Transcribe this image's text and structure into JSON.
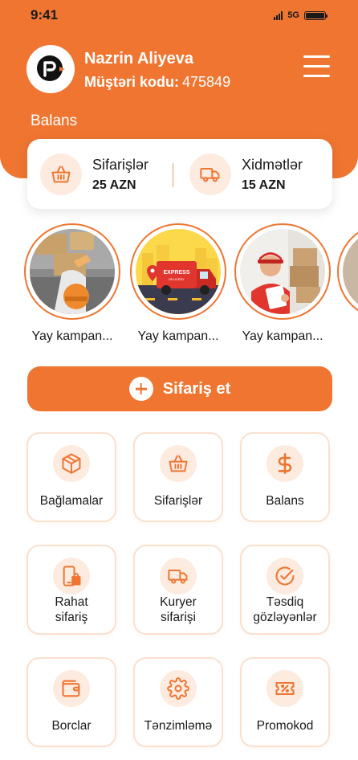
{
  "status_bar": {
    "time": "9:41",
    "network": "5G"
  },
  "header": {
    "user_name": "Nazrin Aliyeva",
    "customer_code_label": "Müştəri kodu:",
    "customer_code_value": "475849",
    "balance_title": "Balans"
  },
  "balance": [
    {
      "label": "Sifarişlər",
      "amount": "25 AZN",
      "icon": "basket-icon"
    },
    {
      "label": "Xidmətlər",
      "amount": "15 AZN",
      "icon": "truck-icon"
    }
  ],
  "stories": [
    {
      "label": "Yay kampan...",
      "image": "worker-with-boxes"
    },
    {
      "label": "Yay kampan...",
      "image": "express-delivery-van"
    },
    {
      "label": "Yay kampan...",
      "image": "courier-with-clipboard"
    }
  ],
  "order_button": {
    "label": "Sifariş et"
  },
  "tiles": [
    {
      "label": "Bağlamalar",
      "icon": "package-icon"
    },
    {
      "label": "Sifarişlər",
      "icon": "basket-icon"
    },
    {
      "label": "Balans",
      "icon": "dollar-icon"
    },
    {
      "label_line1": "Rahat",
      "label_line2": "sifariş",
      "icon": "phone-bag-icon"
    },
    {
      "label_line1": "Kuryer",
      "label_line2": "sifarişi",
      "icon": "truck-icon"
    },
    {
      "label_line1": "Təsdiq",
      "label_line2": "gözləyənlər",
      "icon": "check-circle-icon"
    },
    {
      "label": "Borclar",
      "icon": "wallet-icon"
    },
    {
      "label": "Tənzimləmə",
      "icon": "gear-icon"
    },
    {
      "label": "Promokod",
      "icon": "ticket-icon"
    }
  ],
  "colors": {
    "accent": "#ef7531",
    "accent_light": "#fdebe0",
    "tile_border": "#fbe0cf"
  }
}
